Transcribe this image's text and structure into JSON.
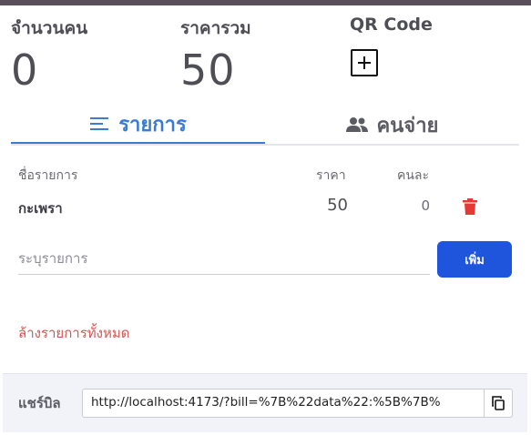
{
  "stats": {
    "people_label": "จำนวนคน",
    "people_value": "0",
    "total_label": "ราคารวม",
    "total_value": "50",
    "qr_label": "QR Code"
  },
  "tabs": [
    {
      "label": "รายการ",
      "icon": "list-icon",
      "active": true
    },
    {
      "label": "คนจ่าย",
      "icon": "people-icon",
      "active": false
    }
  ],
  "table": {
    "headers": {
      "name": "ชื่อรายการ",
      "price": "ราคา",
      "each": "คนละ"
    },
    "rows": [
      {
        "name": "กะเพรา",
        "price": "50",
        "each": "0"
      }
    ]
  },
  "add_item": {
    "placeholder": "ระบุรายการ",
    "button_label": "เพิ่ม"
  },
  "clear_all_label": "ล้างรายการทั้งหมด",
  "share": {
    "label": "แชร์บิล",
    "url": "http://localhost:4173/?bill=%7B%22data%22:%5B%7B%"
  },
  "colors": {
    "accent": "#3a7bd5",
    "button": "#1f54dc",
    "danger": "#d9534f",
    "trash": "#e53935"
  }
}
